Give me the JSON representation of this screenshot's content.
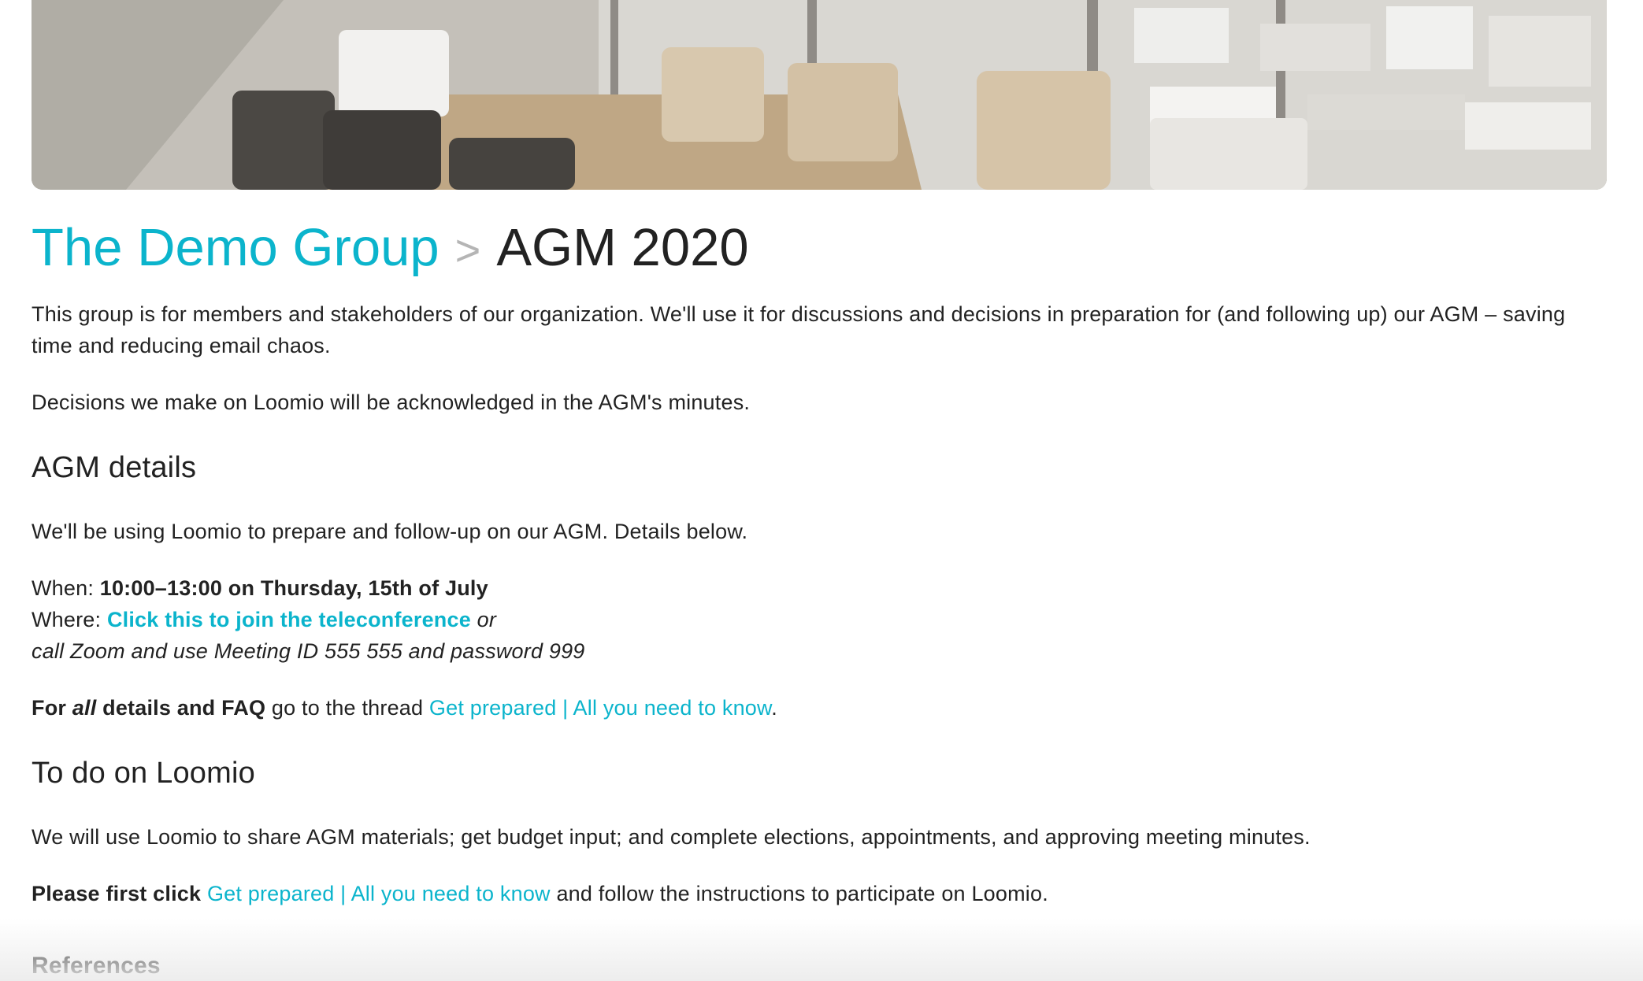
{
  "cover": {
    "alt": "Meeting room with table and chairs by a window overlooking the city"
  },
  "breadcrumb": {
    "group_name": "The Demo Group",
    "separator": ">",
    "discussion_title": "AGM 2020"
  },
  "description": {
    "intro": "This group is for members and stakeholders of our organization. We'll use it for discussions and decisions in preparation for (and following up) our AGM – saving time and reducing email chaos.",
    "decisions": "Decisions we make on Loomio will be acknowledged in the AGM's minutes.",
    "agm_heading": "AGM details",
    "using": "We'll be using Loomio to prepare and follow-up on our AGM. Details below.",
    "when_label": "When: ",
    "when_value": "10:00–13:00 on Thursday, 15th of July",
    "where_label": "Where: ",
    "where_link": "Click this to join the teleconference",
    "where_or": " or",
    "call_instructions": "call Zoom and use Meeting ID 555 555 and password 999",
    "forall_prefix": "For ",
    "forall_all": "all",
    "forall_suffix": " details and FAQ",
    "forall_middle": " go to the thread ",
    "thread_link": "Get prepared | All you need to know",
    "forall_end": ".",
    "todo_heading": "To do on Loomio",
    "share": "We will use Loomio to share AGM materials; get budget input; and complete elections, appointments, and approving meeting minutes.",
    "please_bold": "Please first click",
    "please_link": "Get prepared | All you need to know",
    "please_rest": " and follow the instructions to participate on Loomio.",
    "references_heading": "References"
  },
  "colors": {
    "accent": "#0bb4cc",
    "text": "#222222",
    "separator": "#b5b5b5"
  }
}
